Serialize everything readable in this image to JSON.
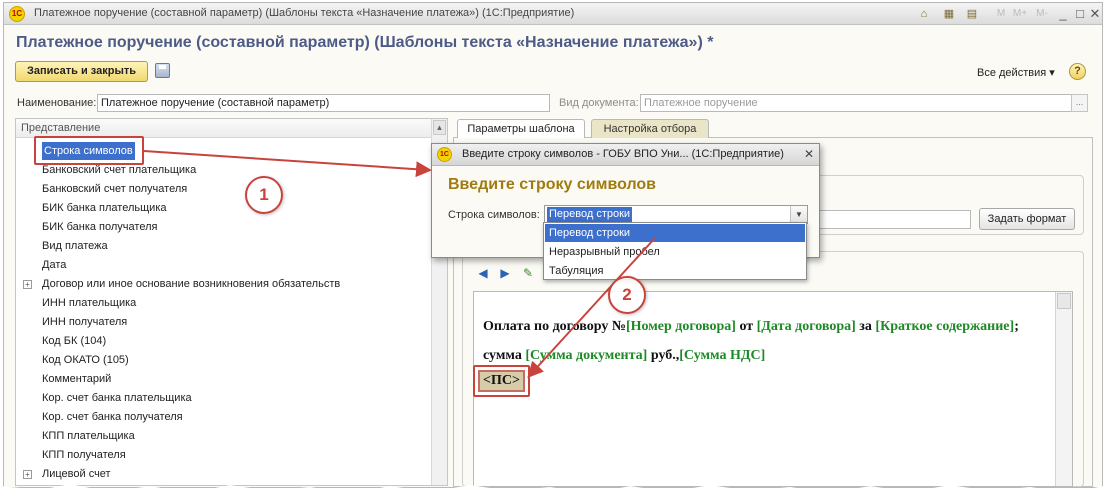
{
  "window": {
    "title": "Платежное поручение (составной параметр) (Шаблоны текста «Назначение платежа») (1С:Предприятие)",
    "logo_text": "1С",
    "window_controls": [
      "M",
      "M+",
      "M-",
      "_",
      "□",
      "✕"
    ]
  },
  "form": {
    "title": "Платежное поручение (составной параметр) (Шаблоны текста «Назначение платежа») *",
    "save_close_label": "Записать и закрыть",
    "all_actions_label": "Все действия ▾",
    "help_label": "?",
    "name_label": "Наименование:",
    "name_value": "Платежное поручение (составной параметр)",
    "doc_type_label": "Вид документа:",
    "doc_type_value": "Платежное поручение",
    "choose_button": "..."
  },
  "tree": {
    "header": "Представление",
    "items": [
      {
        "label": "Строка символов",
        "selected": true
      },
      {
        "label": "Банковский счет плательщика"
      },
      {
        "label": "Банковский счет получателя"
      },
      {
        "label": "БИК банка плательщика"
      },
      {
        "label": "БИК банка получателя"
      },
      {
        "label": "Вид платежа"
      },
      {
        "label": "Дата"
      },
      {
        "label": "Договор или иное основание возникновения обязательств",
        "expandable": true
      },
      {
        "label": "ИНН плательщика"
      },
      {
        "label": "ИНН получателя"
      },
      {
        "label": "Код БК (104)"
      },
      {
        "label": "Код ОКАТО (105)"
      },
      {
        "label": "Комментарий"
      },
      {
        "label": "Кор. счет банка плательщика"
      },
      {
        "label": "Кор. счет банка получателя"
      },
      {
        "label": "КПП плательщика"
      },
      {
        "label": "КПП получателя"
      },
      {
        "label": "Лицевой счет",
        "expandable": true
      }
    ]
  },
  "tabs": [
    {
      "label": "Параметры шаблона",
      "active": true
    },
    {
      "label": "Настройка отбора",
      "active": false
    }
  ],
  "format_button": "Задать формат",
  "editor": {
    "segments": [
      {
        "text": "Оплата по договору №",
        "param": false
      },
      {
        "text": "[Номер договора]",
        "param": true
      },
      {
        "text": " от ",
        "param": false
      },
      {
        "text": "[Дата договора]",
        "param": true
      },
      {
        "text": " за ",
        "param": false
      },
      {
        "text": "[Краткое содержание]",
        "param": true
      },
      {
        "text": "; сумма ",
        "param": false
      },
      {
        "text": "[Сумма документа]",
        "param": true
      },
      {
        "text": " руб.,",
        "param": false
      },
      {
        "text": "[Сумма НДС]",
        "param": true
      }
    ],
    "inserted_tag": "<ПС>"
  },
  "dialog": {
    "logo_text": "1С",
    "title": "Введите строку символов - ГОБУ ВПО Уни... (1С:Предприятие)",
    "close_label": "✕",
    "heading": "Введите строку символов",
    "field_label": "Строка символов:",
    "selected_value": "Перевод строки",
    "options": [
      {
        "label": "Перевод строки",
        "selected": true
      },
      {
        "label": "Неразрывный пробел",
        "selected": false
      },
      {
        "label": "Табуляция",
        "selected": false
      }
    ]
  },
  "annotations": {
    "step1": "1",
    "step2": "2",
    "color": "#c9433d"
  },
  "colors": {
    "title_blue": "#4d5b86",
    "dialog_heading": "#a07c10",
    "param_green": "#1e8a26",
    "selection_blue": "#3d6fcc"
  }
}
